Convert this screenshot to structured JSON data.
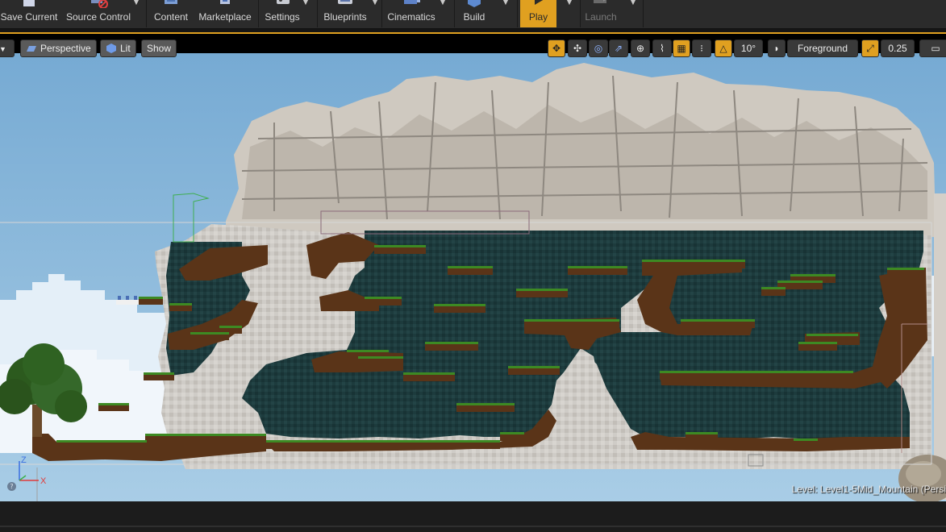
{
  "toolbar": {
    "save_current": "Save Current",
    "source_control": "Source Control",
    "content": "Content",
    "marketplace": "Marketplace",
    "settings": "Settings",
    "blueprints": "Blueprints",
    "cinematics": "Cinematics",
    "build": "Build",
    "play": "Play",
    "launch": "Launch"
  },
  "viewport": {
    "perspective": "Perspective",
    "lit": "Lit",
    "show": "Show",
    "rotation_snap": "10°",
    "layer": "Foreground",
    "scale_snap": "0.25",
    "axis_z": "Z",
    "axis_x": "X",
    "help": "?",
    "level_text": "Level:  Level1-5Mid_Mountain (Persi"
  },
  "colors": {
    "toolbar_bg": "#2b2b2b",
    "accent": "#e0a020",
    "sky": "#7fb2d8",
    "rock": "#c9c5bf",
    "cave": "#1e3a3c",
    "dirt": "#5a3418",
    "grass": "#3d8a23"
  }
}
